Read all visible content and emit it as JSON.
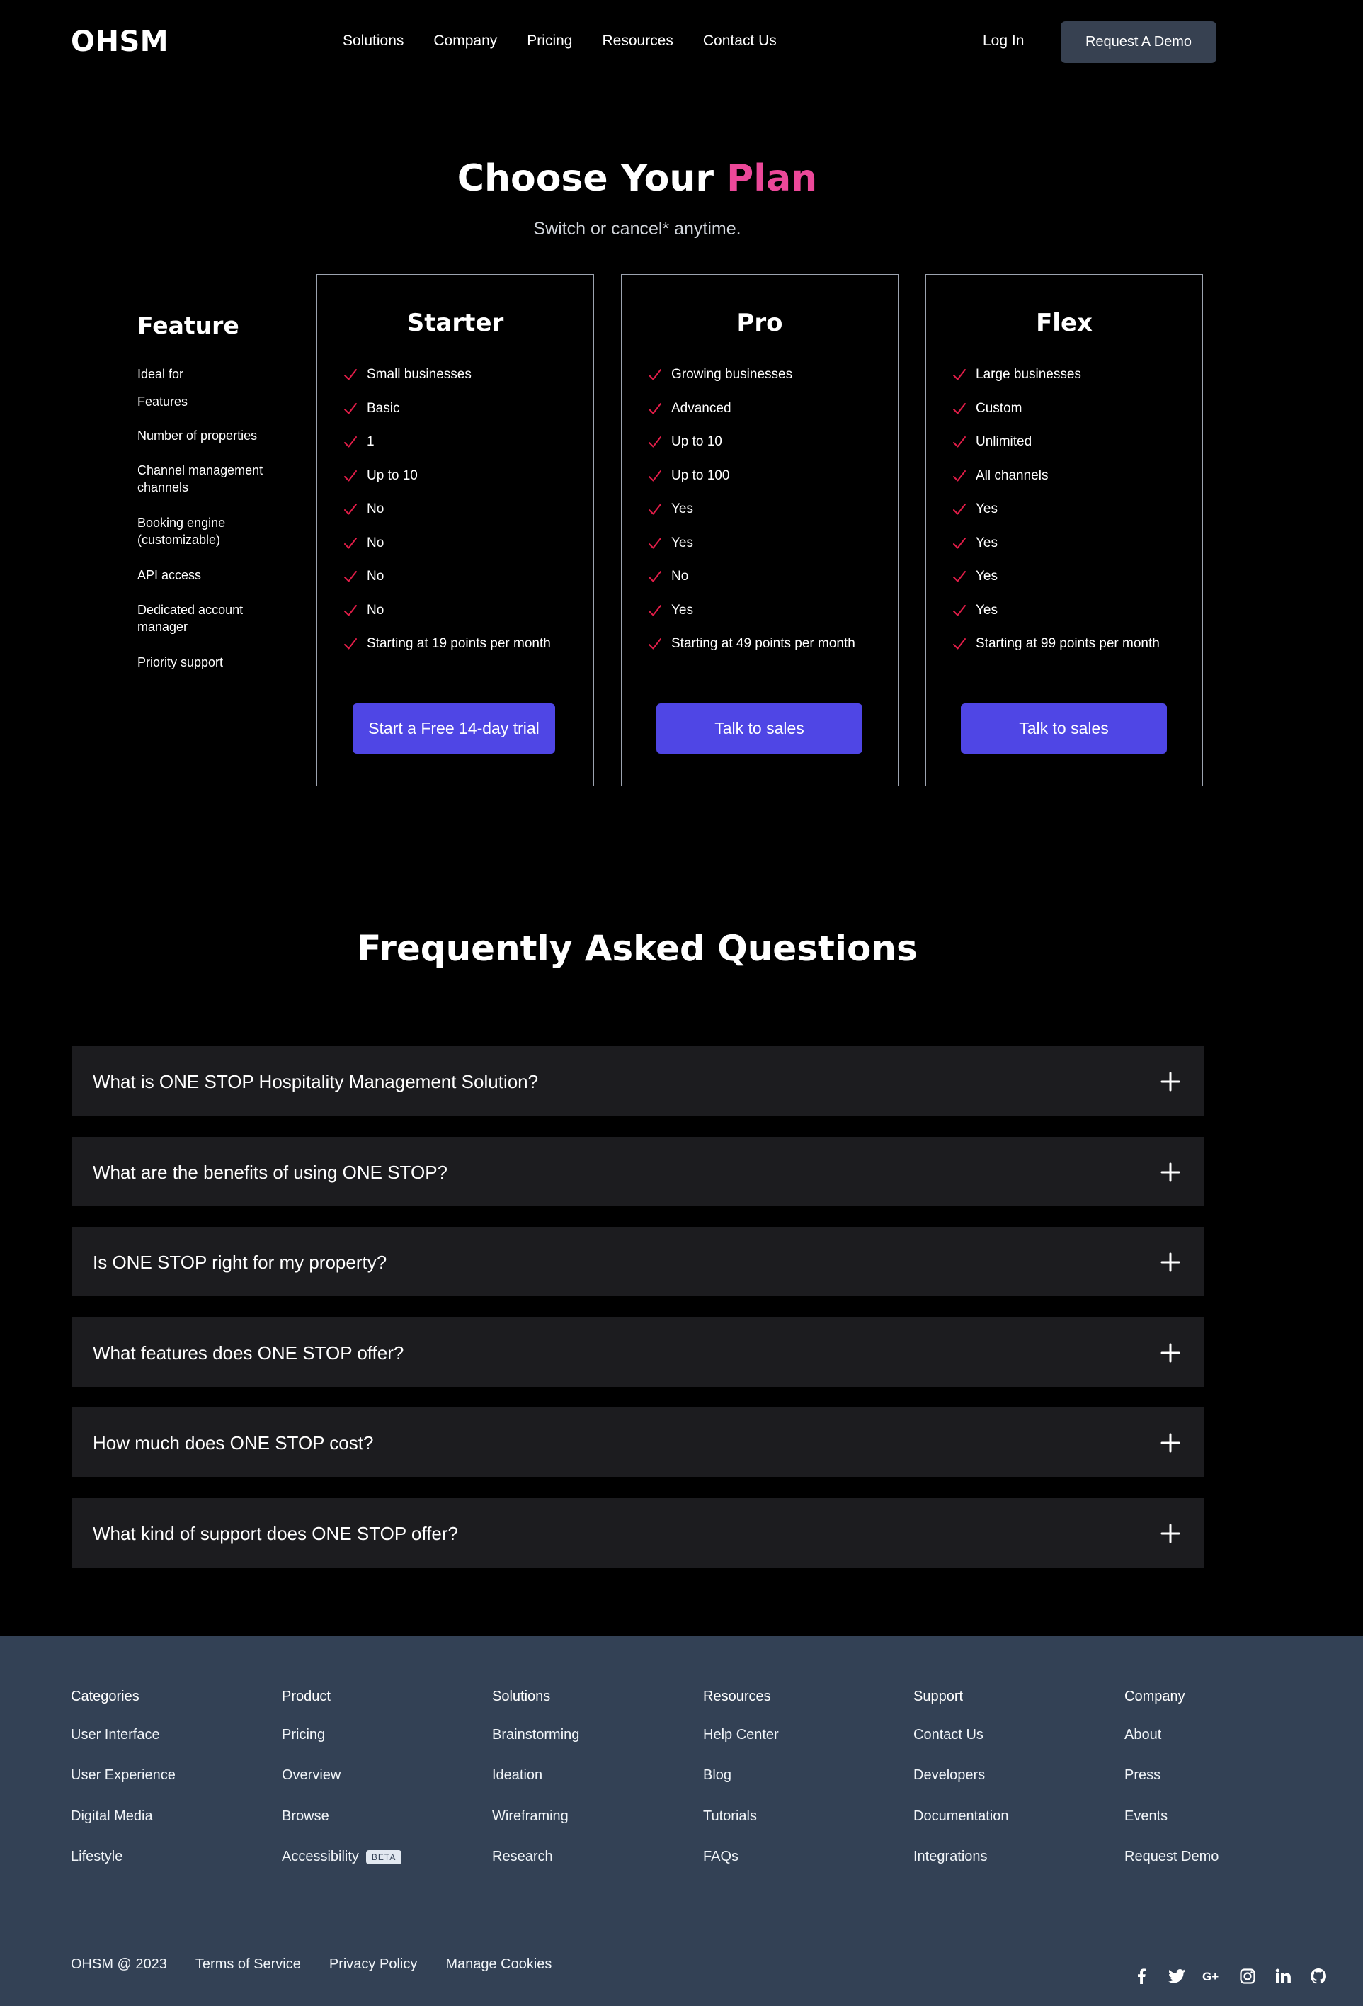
{
  "header": {
    "logo": "OHSM",
    "nav": [
      "Solutions",
      "Company",
      "Pricing",
      "Resources",
      "Contact Us"
    ],
    "login_label": "Log In",
    "demo_label": "Request A Demo"
  },
  "hero": {
    "title_prefix": "Choose Your",
    "title_accent": "Plan",
    "subtitle": "Switch or cancel* anytime."
  },
  "features": {
    "title": "Feature",
    "rows": [
      "Ideal for",
      "Features",
      "Number of properties",
      "Channel management channels",
      "Booking engine (customizable)",
      "API access",
      "Dedicated account manager",
      "Priority support"
    ]
  },
  "plans": [
    {
      "name": "Starter",
      "items": [
        "Small businesses",
        "Basic",
        "1",
        "Up to 10",
        "No",
        "No",
        "No",
        "No",
        "Starting at 19 points per month"
      ],
      "button": "Start a Free 14-day trial"
    },
    {
      "name": "Pro",
      "items": [
        "Growing businesses",
        "Advanced",
        "Up to 10",
        "Up to 100",
        "Yes",
        "Yes",
        "No",
        "Yes",
        "Starting at 49 points per month"
      ],
      "button": "Talk to sales"
    },
    {
      "name": "Flex",
      "items": [
        "Large businesses",
        "Custom",
        "Unlimited",
        "All channels",
        "Yes",
        "Yes",
        "Yes",
        "Yes",
        "Starting at 99 points per month"
      ],
      "button": "Talk to sales"
    }
  ],
  "faq": {
    "title": "Frequently Asked Questions",
    "questions": [
      "What is ONE STOP Hospitality Management Solution?",
      "What are the benefits of using ONE STOP?",
      "Is ONE STOP right for my property?",
      "What features does ONE STOP offer?",
      "How much does ONE STOP cost?",
      "What kind of support does ONE STOP offer?"
    ]
  },
  "footer": {
    "columns": [
      {
        "title": "Categories",
        "links": [
          "User Interface",
          "User Experience",
          "Digital Media",
          "Lifestyle"
        ]
      },
      {
        "title": "Product",
        "links": [
          "Pricing",
          "Overview",
          "Browse",
          "Accessibility"
        ],
        "badge": "BETA"
      },
      {
        "title": "Solutions",
        "links": [
          "Brainstorming",
          "Ideation",
          "Wireframing",
          "Research"
        ]
      },
      {
        "title": "Resources",
        "links": [
          "Help Center",
          "Blog",
          "Tutorials",
          "FAQs"
        ]
      },
      {
        "title": "Support",
        "links": [
          "Contact Us",
          "Developers",
          "Documentation",
          "Integrations"
        ]
      },
      {
        "title": "Company",
        "links": [
          "About",
          "Press",
          "Events",
          "Request Demo"
        ]
      }
    ],
    "copyright": "OHSM @ 2023",
    "legal": [
      "Terms of Service",
      "Privacy Policy",
      "Manage Cookies"
    ],
    "socials": [
      "facebook-icon",
      "twitter-icon",
      "google-plus-icon",
      "instagram-icon",
      "linkedin-icon",
      "github-icon"
    ]
  },
  "colors": {
    "accent": "#ec4899",
    "button": "#4f46e5",
    "check": "#e11d48",
    "faq_bg": "#1c1c1f",
    "footer_bg": "#334155"
  }
}
